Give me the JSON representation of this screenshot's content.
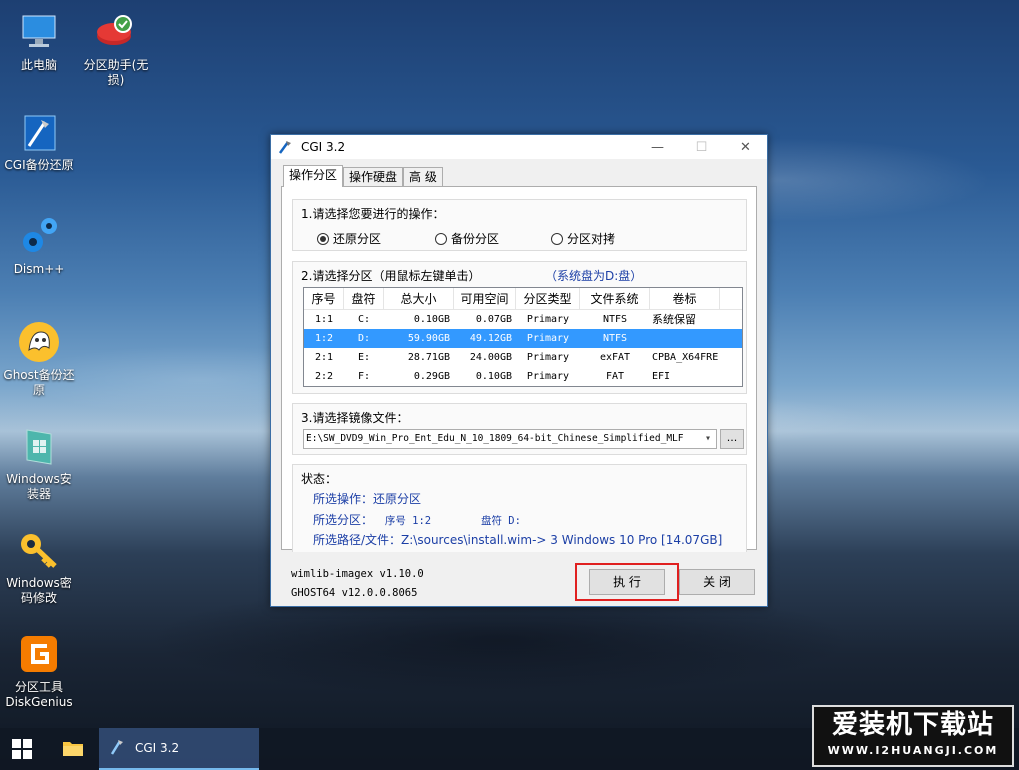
{
  "desktop": {
    "icons": [
      {
        "label": "此电脑",
        "icon": "computer-icon"
      },
      {
        "label": "分区助手(无损)",
        "icon": "partition-assistant-icon"
      },
      {
        "label": "CGI备份还原",
        "icon": "cgi-icon"
      },
      {
        "label": "Dism++",
        "icon": "gears-icon"
      },
      {
        "label": "Ghost备份还原",
        "icon": "ghost-icon"
      },
      {
        "label": "Windows安装器",
        "icon": "windows-installer-icon"
      },
      {
        "label": "Windows密码修改",
        "icon": "key-icon"
      },
      {
        "label": "分区工具DiskGenius",
        "icon": "diskgenius-icon"
      }
    ]
  },
  "window": {
    "title": "CGI 3.2",
    "controls": {
      "minimize": "—",
      "maximize": "☐",
      "close": "✕"
    },
    "tabs": [
      "操作分区",
      "操作硬盘",
      "高 级"
    ],
    "section1": {
      "title": "1.请选择您要进行的操作：",
      "options": [
        {
          "label": "还原分区",
          "selected": true
        },
        {
          "label": "备份分区",
          "selected": false
        },
        {
          "label": "分区对拷",
          "selected": false
        }
      ]
    },
    "section2": {
      "title": "2.请选择分区（用鼠标左键单击）",
      "system_note": "（系统盘为D:盘）",
      "columns": [
        "序号",
        "盘符",
        "总大小",
        "可用空间",
        "分区类型",
        "文件系统",
        "卷标"
      ],
      "rows": [
        {
          "index": "1:1",
          "letter": "C:",
          "total": "0.10GB",
          "free": "0.07GB",
          "type": "Primary",
          "fs": "NTFS",
          "label": "系统保留",
          "selected": false
        },
        {
          "index": "1:2",
          "letter": "D:",
          "total": "59.90GB",
          "free": "49.12GB",
          "type": "Primary",
          "fs": "NTFS",
          "label": "",
          "selected": true
        },
        {
          "index": "2:1",
          "letter": "E:",
          "total": "28.71GB",
          "free": "24.00GB",
          "type": "Primary",
          "fs": "exFAT",
          "label": "CPBA_X64FRE",
          "selected": false
        },
        {
          "index": "2:2",
          "letter": "F:",
          "total": "0.29GB",
          "free": "0.10GB",
          "type": "Primary",
          "fs": "FAT",
          "label": "EFI",
          "selected": false
        }
      ]
    },
    "section3": {
      "title": "3.请选择镜像文件：",
      "value": "E:\\SW_DVD9_Win_Pro_Ent_Edu_N_10_1809_64-bit_Chinese_Simplified_MLF",
      "browse_label": "..."
    },
    "status": {
      "title": "状态：",
      "operation": "所选操作：还原分区",
      "partition_prefix": "所选分区：",
      "partition_index": "序号 1:2",
      "partition_letter": "盘符 D:",
      "path": "所选路径/文件：Z:\\sources\\install.wim-> 3  Windows 10 Pro [14.07GB]"
    },
    "footer": {
      "wimlib": "wimlib-imagex v1.10.0",
      "ghost": "GHOST64 v12.0.0.8065",
      "execute_label": "执 行",
      "close_label": "关 闭"
    }
  },
  "taskbar": {
    "app_label": "CGI 3.2"
  },
  "watermark": {
    "title": "爱装机下载站",
    "url": "WWW.I2HUANGJI.COM"
  }
}
